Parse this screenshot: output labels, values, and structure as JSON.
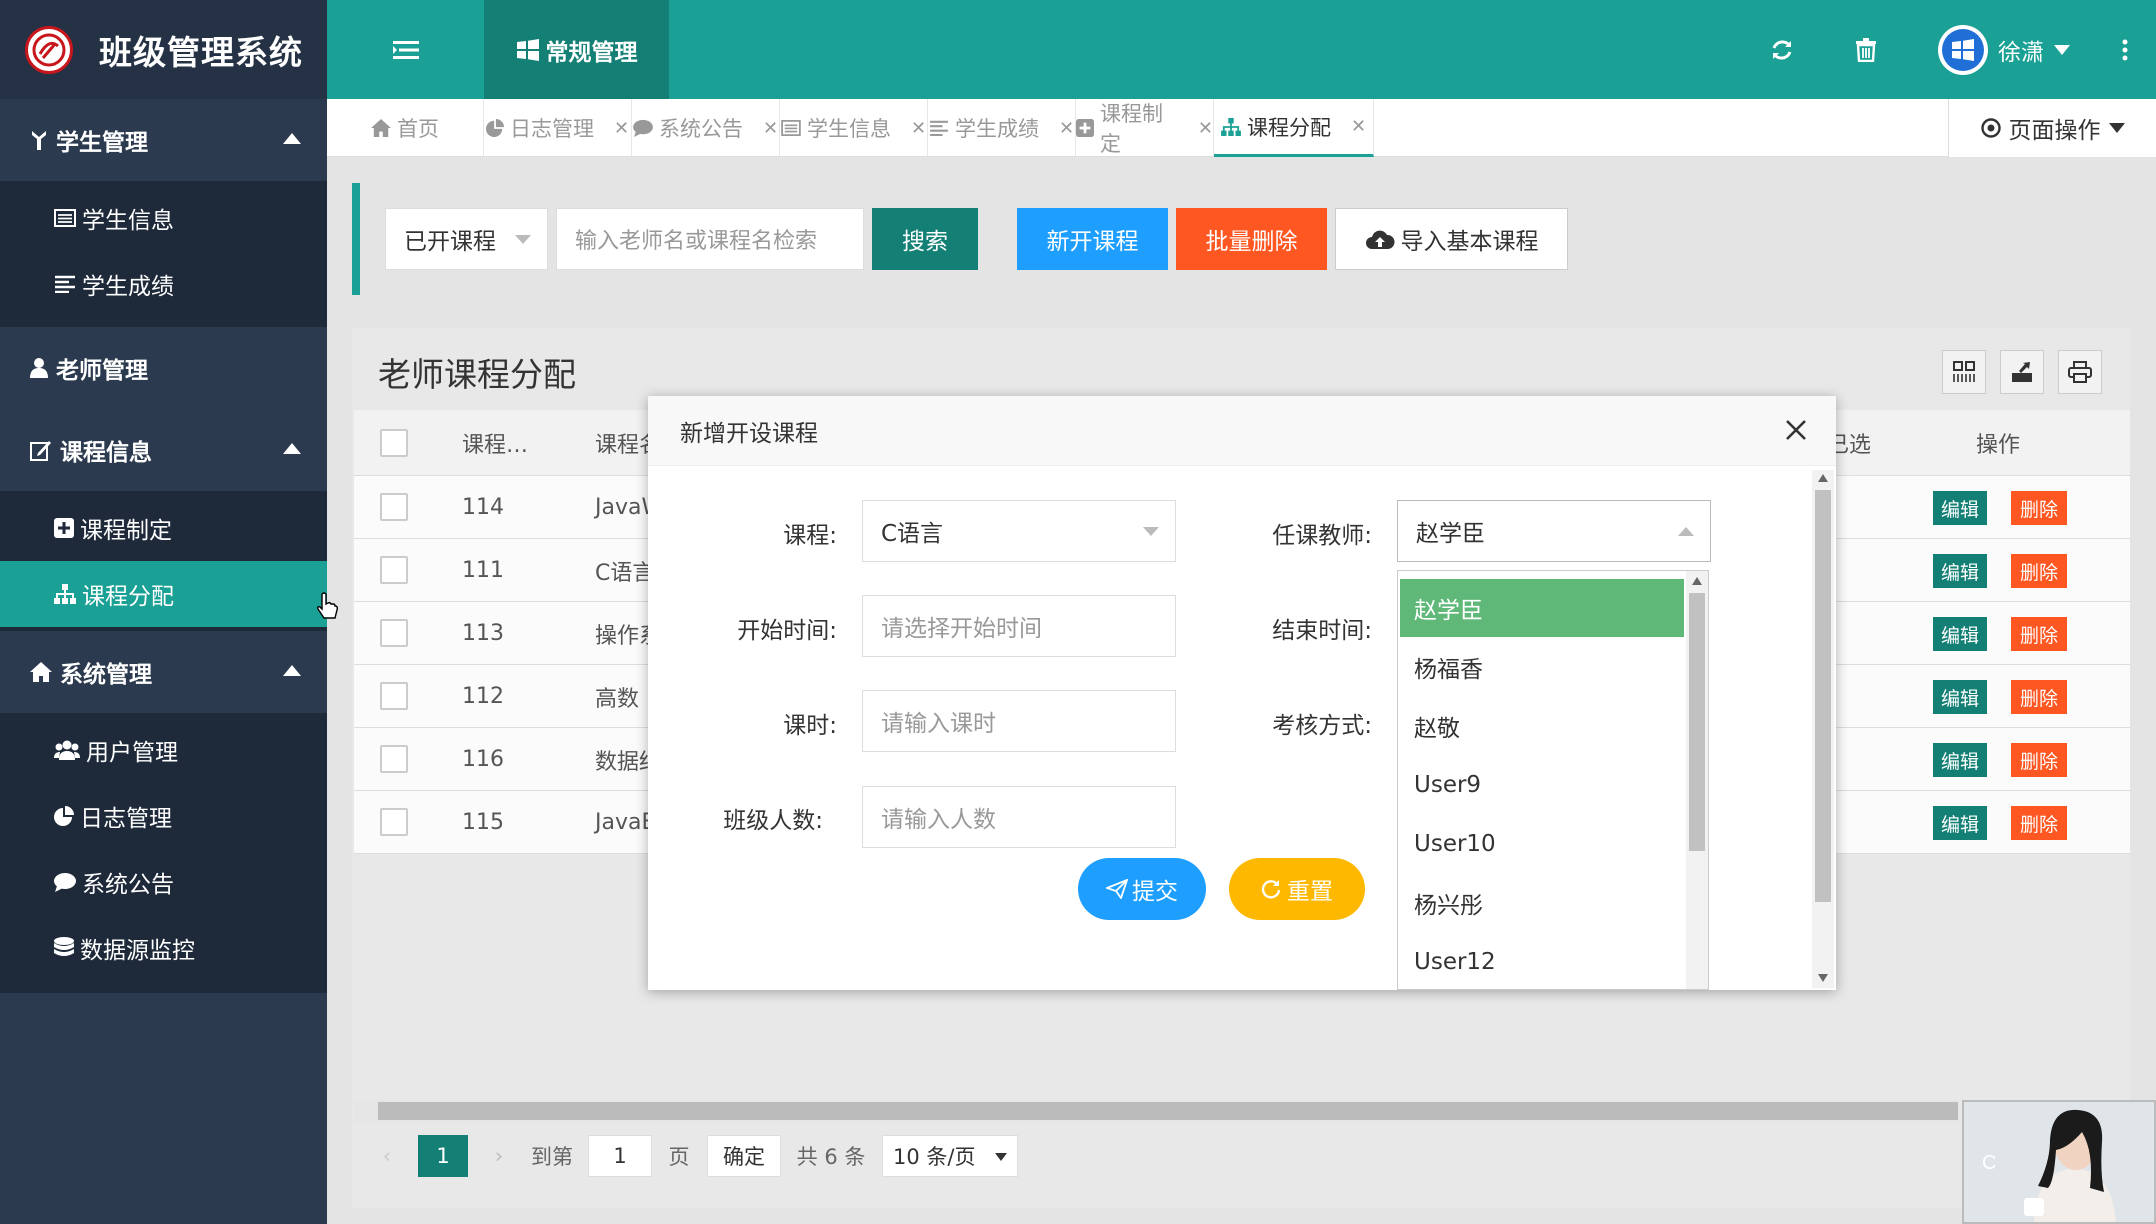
{
  "app": {
    "title": "班级管理系统",
    "top_nav_active": "常规管理",
    "user_name": "徐潇"
  },
  "colors": {
    "primary": "#1aa094",
    "dark": "#253246",
    "sidebar": "#2b3a4e",
    "blue": "#1e9fff",
    "orange": "#ff5722",
    "yellow": "#ffb800",
    "green_selected": "#5fb878"
  },
  "sidebar": {
    "groups": [
      {
        "label": "学生管理",
        "icon": "student-icon",
        "items": [
          "学生信息",
          "学生成绩"
        ]
      },
      {
        "label": "老师管理",
        "icon": "user-icon",
        "items": []
      },
      {
        "label": "课程信息",
        "icon": "edit-icon",
        "items": [
          "课程制定",
          "课程分配"
        ]
      },
      {
        "label": "系统管理",
        "icon": "home-icon",
        "items": [
          "用户管理",
          "日志管理",
          "系统公告",
          "数据源监控"
        ]
      }
    ],
    "active_item": "课程分配"
  },
  "tabs": [
    "首页",
    "日志管理",
    "系统公告",
    "学生信息",
    "学生成绩",
    "课程制定",
    "课程分配"
  ],
  "active_tab": "课程分配",
  "page_ops": "页面操作",
  "toolbar": {
    "filter_value": "已开课程",
    "search_placeholder": "输入老师名或课程名检索",
    "search_label": "搜索",
    "new_label": "新开课程",
    "batch_delete_label": "批量删除",
    "import_label": "导入基本课程"
  },
  "table": {
    "title": "老师课程分配",
    "headers": [
      "课程…",
      "课程名",
      "已选",
      "操作"
    ],
    "rows": [
      {
        "id": "114",
        "name": "JavaW"
      },
      {
        "id": "111",
        "name": "C语言"
      },
      {
        "id": "113",
        "name": "操作系"
      },
      {
        "id": "112",
        "name": "高数"
      },
      {
        "id": "116",
        "name": "数据结"
      },
      {
        "id": "115",
        "name": "JavaE"
      }
    ],
    "edit_label": "编辑",
    "delete_label": "删除"
  },
  "pager": {
    "current": "1",
    "goto_label": "到第",
    "goto_value": "1",
    "page_unit": "页",
    "confirm": "确定",
    "total": "共 6 条",
    "per_page": "10 条/页"
  },
  "modal": {
    "title": "新增开设课程",
    "course_label": "课程:",
    "course_value": "C语言",
    "teacher_label": "任课教师:",
    "teacher_value": "赵学臣",
    "start_label": "开始时间:",
    "start_placeholder": "请选择开始时间",
    "end_label": "结束时间:",
    "hours_label": "课时:",
    "hours_placeholder": "请输入课时",
    "assess_label": "考核方式:",
    "class_size_label": "班级人数:",
    "class_size_placeholder": "请输入人数",
    "submit_label": "提交",
    "reset_label": "重置"
  },
  "teacher_options": [
    "赵学臣",
    "杨福香",
    "赵敬",
    "User9",
    "User10",
    "杨兴彤",
    "User12"
  ],
  "float_photo_text": "C"
}
